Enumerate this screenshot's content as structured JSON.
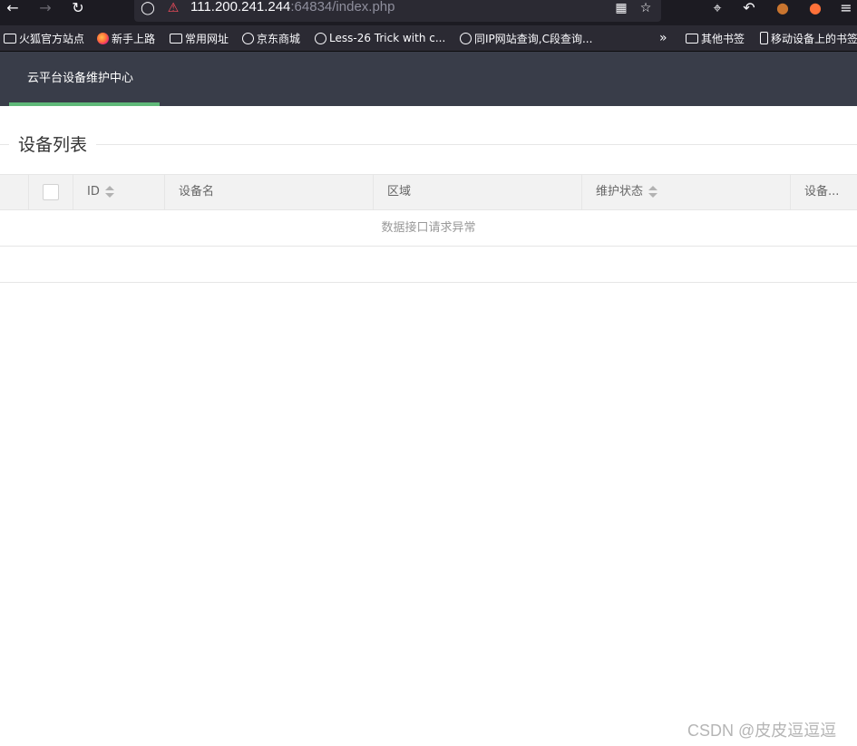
{
  "browser": {
    "url_host": "111.200.241.244",
    "url_rest": ":64834/index.php",
    "bookmarks": [
      {
        "label": "火狐官方站点",
        "icon": "folder-icon"
      },
      {
        "label": "新手上路",
        "icon": "firefox-icon"
      },
      {
        "label": "常用网址",
        "icon": "folder-icon"
      },
      {
        "label": "京东商城",
        "icon": "globe-icon"
      },
      {
        "label": "Less-26 Trick with c...",
        "icon": "globe-icon"
      },
      {
        "label": "同IP网站查询,C段查询...",
        "icon": "globe-icon"
      }
    ],
    "other_bookmarks": "其他书签",
    "mobile_bookmarks": "移动设备上的书签"
  },
  "header": {
    "nav_title": "云平台设备维护中心",
    "accent_color": "#5fb878",
    "bg_color": "#393d49"
  },
  "main": {
    "fieldset_title": "设备列表",
    "table": {
      "columns": [
        "ID",
        "设备名",
        "区域",
        "维护状态",
        "设备..."
      ],
      "empty_message": "数据接口请求异常"
    }
  },
  "watermark": "CSDN @皮皮逗逗逗"
}
